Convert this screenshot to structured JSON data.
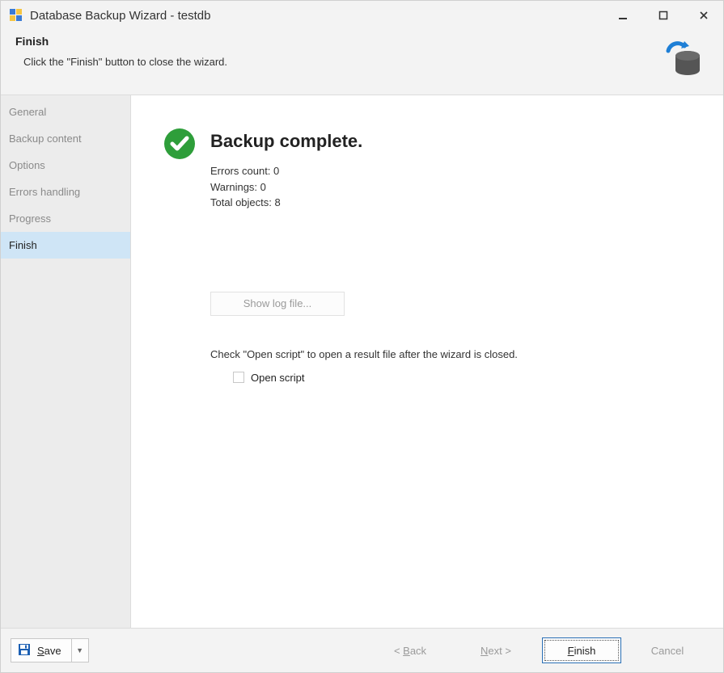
{
  "window": {
    "title": "Database Backup Wizard - testdb"
  },
  "header": {
    "title": "Finish",
    "subtitle": "Click the \"Finish\" button to close the wizard."
  },
  "sidebar": {
    "items": [
      {
        "label": "General"
      },
      {
        "label": "Backup content"
      },
      {
        "label": "Options"
      },
      {
        "label": "Errors handling"
      },
      {
        "label": "Progress"
      },
      {
        "label": "Finish"
      }
    ]
  },
  "status": {
    "heading": "Backup complete.",
    "errors_label": "Errors count:",
    "errors_value": "0",
    "warnings_label": "Warnings:",
    "warnings_value": "0",
    "objects_label": "Total objects:",
    "objects_value": "8"
  },
  "log_button": "Show log file...",
  "open_script_hint": "Check \"Open script\" to open a result file after the wizard is closed.",
  "open_script_label": "Open script",
  "footer": {
    "save": "Save",
    "back": "< Back",
    "next": "Next >",
    "finish": "Finish",
    "cancel": "Cancel"
  }
}
